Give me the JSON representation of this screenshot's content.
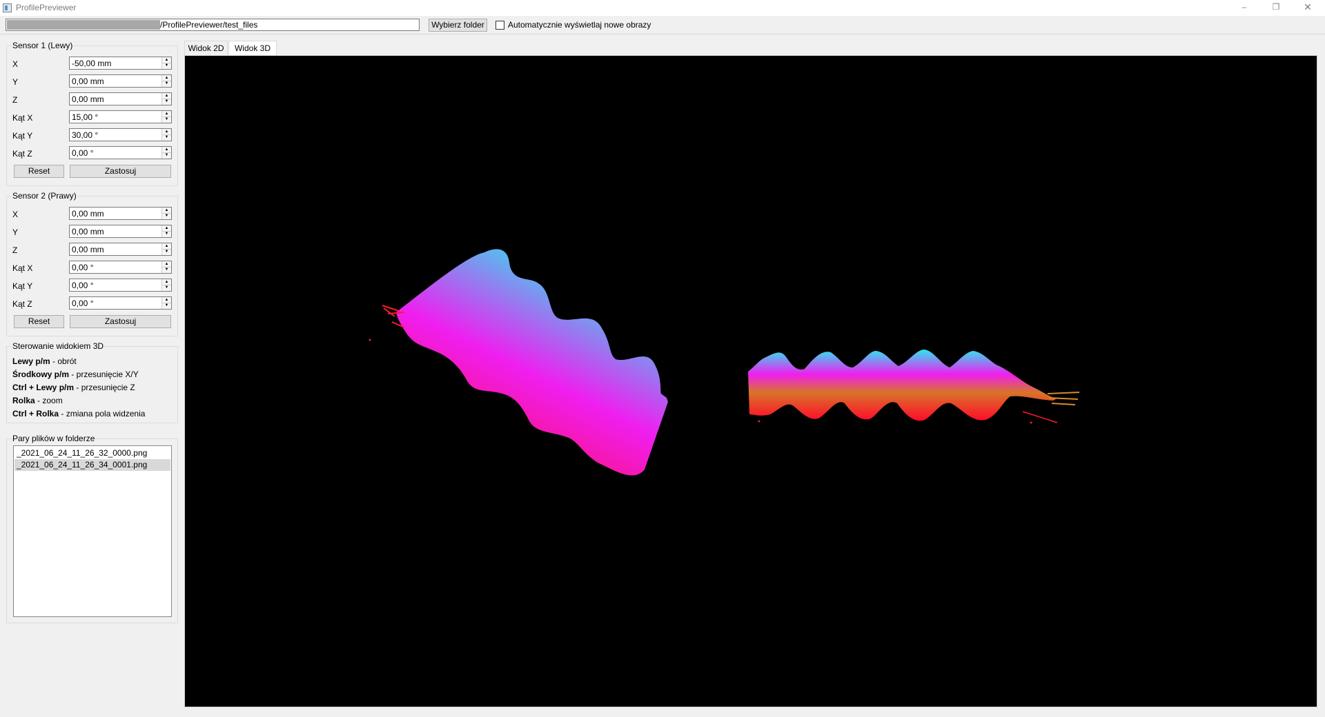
{
  "window": {
    "title": "ProfilePreviewer",
    "minimize_glyph": "–",
    "restore_glyph": "❐",
    "close_glyph": "✕"
  },
  "toolbar": {
    "path_value": "/ProfilePreviewer/test_files",
    "choose_folder_label": "Wybierz folder",
    "auto_show_label": "Automatycznie wyświetlaj nowe obrazy",
    "auto_show_checked": false
  },
  "sensor1": {
    "title": "Sensor 1 (Lewy)",
    "fields": [
      {
        "label": "X",
        "value": "-50,00 mm"
      },
      {
        "label": "Y",
        "value": "0,00 mm"
      },
      {
        "label": "Z",
        "value": "0,00 mm"
      },
      {
        "label": "Kąt X",
        "value": "15,00 °"
      },
      {
        "label": "Kąt Y",
        "value": "30,00 °"
      },
      {
        "label": "Kąt Z",
        "value": "0,00 °"
      }
    ],
    "reset_label": "Reset",
    "apply_label": "Zastosuj"
  },
  "sensor2": {
    "title": "Sensor 2 (Prawy)",
    "fields": [
      {
        "label": "X",
        "value": "0,00 mm"
      },
      {
        "label": "Y",
        "value": "0,00 mm"
      },
      {
        "label": "Z",
        "value": "0,00 mm"
      },
      {
        "label": "Kąt X",
        "value": "0,00 °"
      },
      {
        "label": "Kąt Y",
        "value": "0,00 °"
      },
      {
        "label": "Kąt Z",
        "value": "0,00 °"
      }
    ],
    "reset_label": "Reset",
    "apply_label": "Zastosuj"
  },
  "view_controls": {
    "title": "Sterowanie widokiem 3D",
    "lines": [
      {
        "key": "Lewy p/m",
        "desc": " - obrót"
      },
      {
        "key": "Środkowy p/m",
        "desc": " - przesunięcie X/Y"
      },
      {
        "key": "Ctrl + Lewy p/m",
        "desc": " - przesunięcie Z"
      },
      {
        "key": "Rolka",
        "desc": " - zoom"
      },
      {
        "key": "Ctrl + Rolka",
        "desc": " - zmiana pola widzenia"
      }
    ]
  },
  "files": {
    "title": "Pary plików w folderze",
    "items": [
      "_2021_06_24_11_26_32_0000.png",
      "_2021_06_24_11_26_34_0001.png"
    ],
    "selected_index": 1
  },
  "tabs": [
    {
      "label": "Widok 2D",
      "active": false
    },
    {
      "label": "Widok 3D",
      "active": true
    }
  ],
  "colors": {
    "viewport_bg": "#000000",
    "profile_red": "#ff0a2a",
    "profile_magenta": "#f01ef0",
    "profile_cyan": "#2ee6f0",
    "profile_orange": "#d8742a"
  }
}
